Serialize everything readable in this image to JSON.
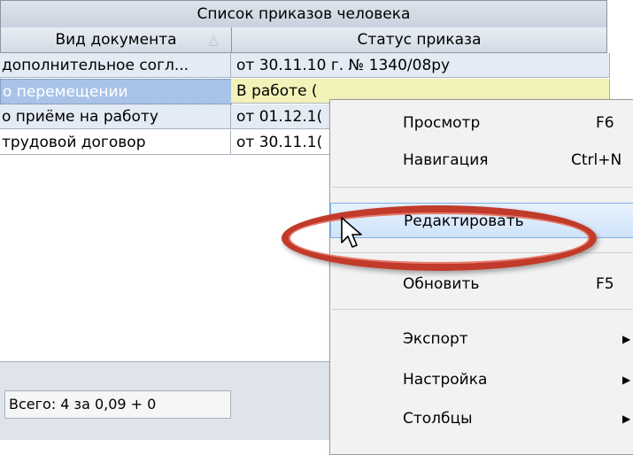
{
  "grid": {
    "title": "Список приказов человека",
    "columns": [
      {
        "label": "Вид документа",
        "sort_icon": "sort-ascending-icon"
      },
      {
        "label": "Статус приказа"
      }
    ],
    "rows": [
      {
        "doc": "дополнительное согл...",
        "status": "от 30.11.10 г. № 1340/08ру"
      },
      {
        "doc": "о перемещении",
        "status": "В работе ("
      },
      {
        "doc": "о приёме на работу",
        "status": "от 01.12.1("
      },
      {
        "doc": "трудовой договор",
        "status": "от 30.11.1("
      }
    ]
  },
  "footer": {
    "total": "Всего: 4 за 0,09 + 0"
  },
  "context_menu": {
    "items": [
      {
        "label": "Просмотр",
        "shortcut": "F6"
      },
      {
        "label": "Навигация",
        "shortcut": "Ctrl+N"
      },
      {
        "label": "Редактировать",
        "shortcut": "",
        "highlighted": true
      },
      {
        "label": "Обновить",
        "shortcut": "F5"
      },
      {
        "label": "Экспорт",
        "submenu": true
      },
      {
        "label": "Настройка",
        "submenu": true
      },
      {
        "label": "Столбцы",
        "submenu": true
      }
    ]
  },
  "colors": {
    "annotation_ring": "#c13a2a",
    "menu_highlight": "#cfe3fa",
    "selected_row": "#a9c3e8"
  }
}
